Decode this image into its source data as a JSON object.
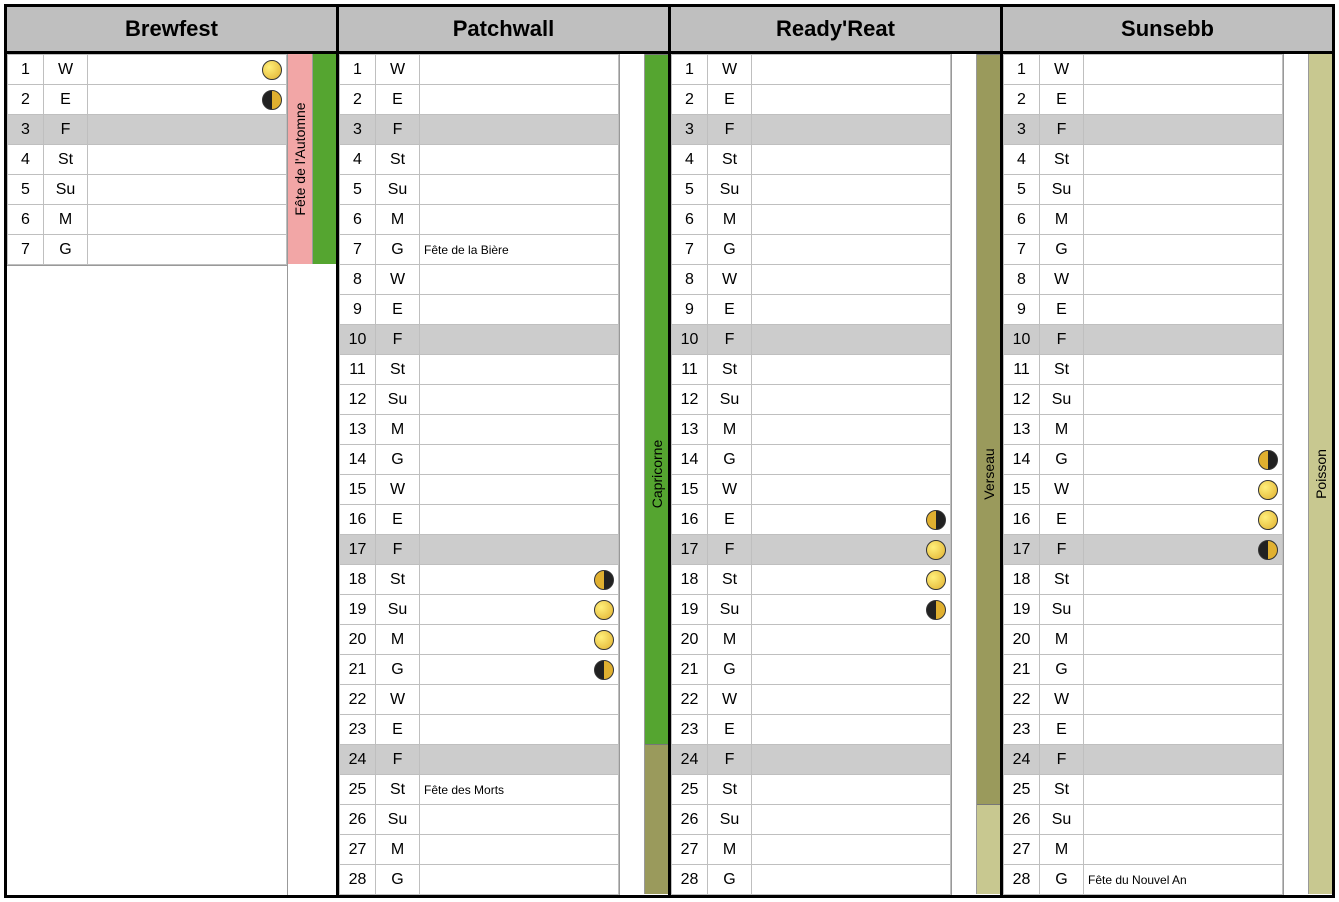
{
  "weekday_labels": [
    "W",
    "E",
    "F",
    "St",
    "Su",
    "M",
    "G"
  ],
  "freeday_index": 2,
  "months": [
    {
      "name": "Brewfest",
      "days": 7,
      "events": {},
      "moons": {
        "1": "full",
        "2": "wane"
      },
      "side_bands": [
        {
          "label": "Fête de l'Automne",
          "bg": "#f2a6a6",
          "top_day": 1,
          "bottom_day": 7
        },
        {
          "label": "",
          "bg": "#55a530",
          "top_day": 1,
          "bottom_day": 7
        }
      ]
    },
    {
      "name": "Patchwall",
      "days": 28,
      "events": {
        "7": "Fête de la Bière",
        "25": "Fête des Morts"
      },
      "moons": {
        "18": "wax",
        "19": "full",
        "20": "full",
        "21": "wane"
      },
      "side_bands": [
        {
          "label": "",
          "bg": "#ffffff",
          "top_day": 1,
          "bottom_day": 28
        },
        {
          "label": "Capricorne",
          "splits": [
            {
              "bg": "#55a530",
              "top_day": 1,
              "bottom_day": 23
            },
            {
              "bg": "#9a9a5c",
              "top_day": 24,
              "bottom_day": 28
            }
          ]
        }
      ]
    },
    {
      "name": "Ready'Reat",
      "days": 28,
      "events": {},
      "moons": {
        "16": "wax",
        "17": "full",
        "18": "full",
        "19": "wane"
      },
      "side_bands": [
        {
          "label": "",
          "bg": "#ffffff",
          "top_day": 1,
          "bottom_day": 28
        },
        {
          "label": "Verseau",
          "splits": [
            {
              "bg": "#9a9a5c",
              "top_day": 1,
              "bottom_day": 25
            },
            {
              "bg": "#c8c890",
              "top_day": 26,
              "bottom_day": 28
            }
          ]
        }
      ]
    },
    {
      "name": "Sunsebb",
      "days": 28,
      "events": {
        "28": "Fête du Nouvel An"
      },
      "moons": {
        "14": "wax",
        "15": "full",
        "16": "full",
        "17": "wane"
      },
      "side_bands": [
        {
          "label": "",
          "bg": "#ffffff",
          "top_day": 1,
          "bottom_day": 28
        },
        {
          "label": "Poisson",
          "bg": "#c8c890",
          "top_day": 1,
          "bottom_day": 28
        }
      ]
    }
  ]
}
